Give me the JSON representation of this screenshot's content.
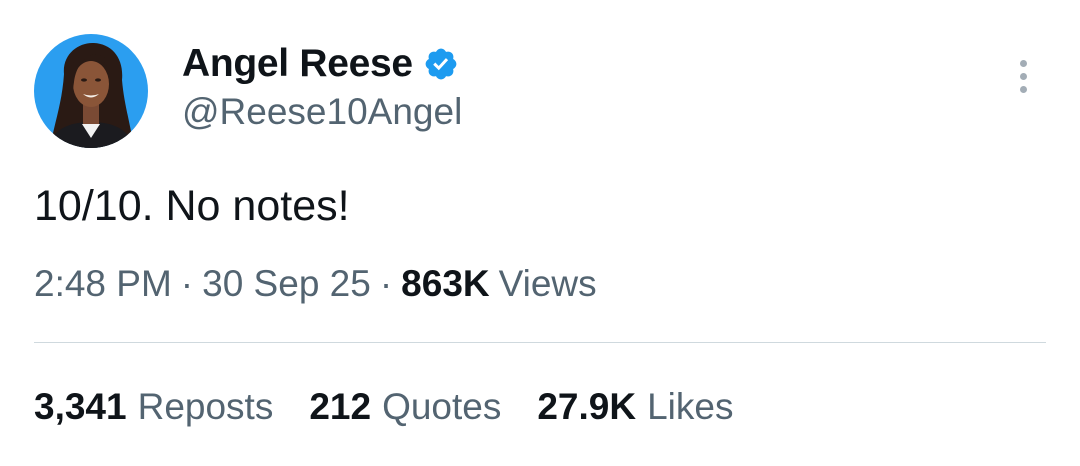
{
  "colors": {
    "text_primary": "#0f1419",
    "text_secondary": "#536471",
    "verified_blue": "#1d9bf0",
    "avatar_background": "#2b9ef0",
    "divider": "#cfd9de"
  },
  "author": {
    "display_name": "Angel Reese",
    "handle": "@Reese10Angel",
    "verified": true,
    "verified_icon": "verified-badge-icon",
    "avatar_icon": "profile-avatar"
  },
  "menu_icon": "more-options-icon",
  "tweet": {
    "text": "10/10. No notes!",
    "time": "2:48 PM",
    "date": "30 Sep 25",
    "separator": "·",
    "views_count": "863K",
    "views_label": "Views"
  },
  "stats": {
    "reposts": {
      "count": "3,341",
      "label": "Reposts"
    },
    "quotes": {
      "count": "212",
      "label": "Quotes"
    },
    "likes": {
      "count": "27.9K",
      "label": "Likes"
    }
  }
}
